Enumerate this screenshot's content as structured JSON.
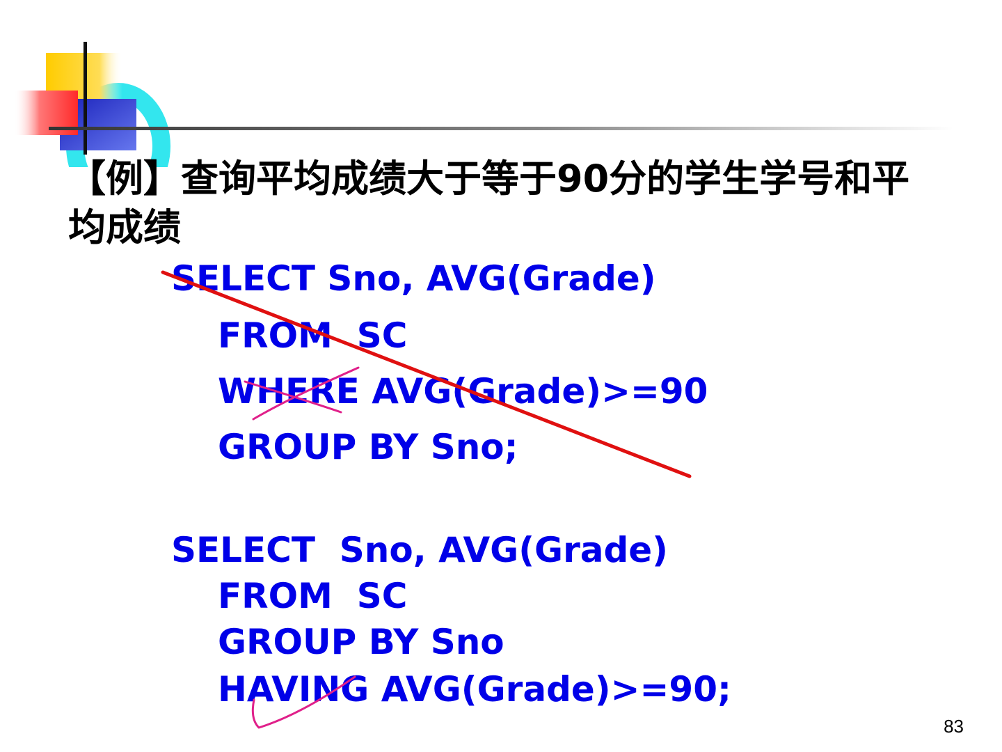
{
  "slide": {
    "title_prefix": "【例】查询平均成绩大于等于",
    "title_number": "90",
    "title_suffix_line1": "分的学生学号和平",
    "title_line2": "均成绩"
  },
  "wrong_query": {
    "line1": "SELECT Sno, AVG(Grade)",
    "line2": "FROM  SC",
    "line3": "WHERE AVG(Grade)>=90",
    "line4": "GROUP BY Sno;"
  },
  "correct_query": {
    "line1": "SELECT  Sno, AVG(Grade)",
    "line2": "FROM  SC",
    "line3": "GROUP BY Sno",
    "line4": "HAVING AVG(Grade)>=90;"
  },
  "page_number": "83",
  "colors": {
    "code": "#0000e8",
    "strike": "#e01010",
    "pen_mark": "#e0208a",
    "logo_yellow": "#ffcc00",
    "logo_red": "#ff3b3b",
    "logo_blue": "#2233cc",
    "logo_cyan": "#33e6ee"
  }
}
